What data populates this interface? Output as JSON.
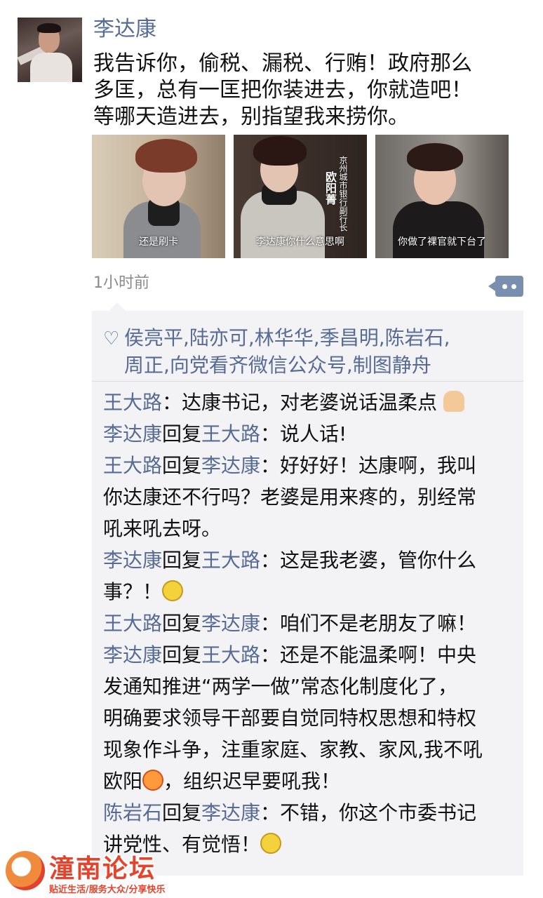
{
  "post": {
    "author": "李达康",
    "text_lines": [
      "我告诉你，偷税、漏税、行贿！政府那么",
      "多匡，总有一匡把你装进去，你就造吧！",
      "等哪天造进去，别指望我来捞你。"
    ],
    "photos": [
      {
        "caption": "还是刷卡"
      },
      {
        "caption": "李达康你什么意思啊",
        "overlay_title": "京州城市银行副行长",
        "overlay_name": "欧阳菁"
      },
      {
        "caption": "你做了裸官就下台了"
      }
    ],
    "time": "1小时前"
  },
  "likes": {
    "names": "侯亮平,陆亦可,林华华,季昌明,陈岩石,",
    "names_line2": "周正,向党看齐微信公众号,制图静舟"
  },
  "comments": [
    {
      "from": "王大路",
      "reply_word": "",
      "to": "",
      "lines": [
        "：达康书记，对老婆说话温柔点 "
      ],
      "emoji": "folded-hands-emoji"
    },
    {
      "from": "李达康",
      "reply_word": "回复",
      "to": "王大路",
      "lines": [
        "：说人话!"
      ],
      "emoji": ""
    },
    {
      "from": "王大路",
      "reply_word": "回复",
      "to": "李达康",
      "lines": [
        "：好好好！达康啊，我叫",
        "你达康还不行吗？老婆是用来疼的，别经常",
        "吼来吼去呀。"
      ],
      "emoji": ""
    },
    {
      "from": "李达康",
      "reply_word": "回复",
      "to": "王大路",
      "lines": [
        "：这是我老婆，管你什么",
        "事？！"
      ],
      "emoji": "smile-emoji"
    },
    {
      "from": "王大路",
      "reply_word": "回复",
      "to": "李达康",
      "lines": [
        "：咱们不是老朋友了嘛！"
      ],
      "emoji": ""
    },
    {
      "from": "李达康",
      "reply_word": "回复",
      "to": "王大路",
      "lines": [
        "：还是不能温柔啊！中央",
        "发通知推进“两学一做”常态化制度化了，",
        "明确要求领导干部要自觉同特权思想和特权",
        "现象作斗争，注重家庭、家教、家风,我不吼",
        "欧阳"
      ],
      "emoji": "angry-emoji",
      "tail": "，组织迟早要吼我！"
    },
    {
      "from": "陈岩石",
      "reply_word": "回复",
      "to": "李达康",
      "lines": [
        "：不错，你这个市委书记",
        "讲党性、有觉悟！"
      ],
      "emoji": "smirk-emoji"
    }
  ],
  "watermark": {
    "title": "潼南论坛",
    "subtitle": "贴近生活/服务大众/分享快乐"
  },
  "colors": {
    "link": "#576b95",
    "comment_bg": "#f3f3f5",
    "accent": "#e6432d"
  }
}
